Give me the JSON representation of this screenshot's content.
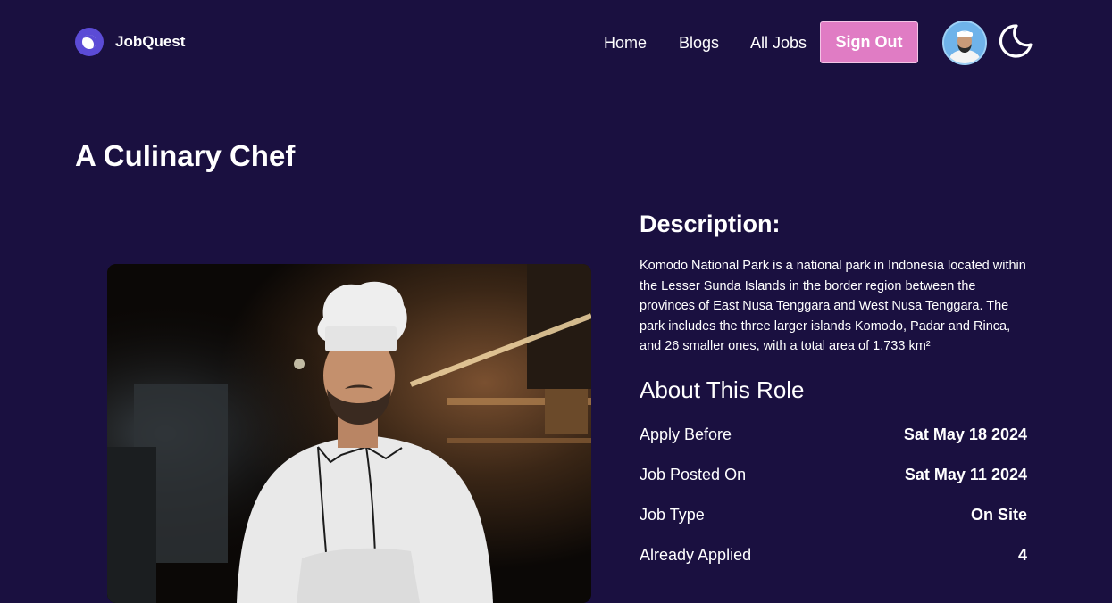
{
  "brand": {
    "name": "JobQuest"
  },
  "nav": {
    "links": [
      "Home",
      "Blogs",
      "All Jobs"
    ],
    "signout_label": "Sign Out"
  },
  "job": {
    "title": "A Culinary Chef",
    "description_heading": "Description:",
    "description": "Komodo National Park is a national park in Indonesia located within the Lesser Sunda Islands in the border region between the provinces of East Nusa Tenggara and West Nusa Tenggara. The park includes the three larger islands Komodo, Padar and Rinca, and 26 smaller ones, with a total area of 1,733 km²",
    "about_heading": "About This Role",
    "details": [
      {
        "label": "Apply Before",
        "value": "Sat May 18 2024"
      },
      {
        "label": "Job Posted On",
        "value": "Sat May 11 2024"
      },
      {
        "label": "Job Type",
        "value": "On Site"
      },
      {
        "label": "Already Applied",
        "value": "4"
      }
    ]
  },
  "colors": {
    "background": "#1a1040",
    "accent": "#e07cc4",
    "logo": "#5b4bd6"
  },
  "icons": {
    "logo": "brand-logo-icon",
    "theme": "moon-icon"
  }
}
